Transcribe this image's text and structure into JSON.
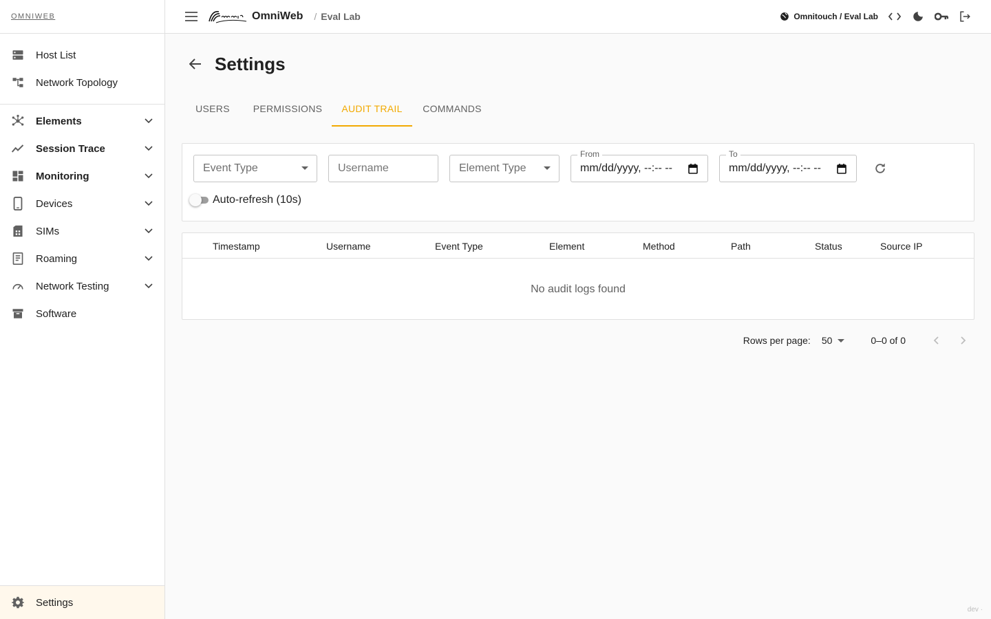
{
  "sidebar": {
    "brand": "OMNIWEB",
    "top_items": [
      {
        "label": "Host List",
        "icon": "server-icon"
      },
      {
        "label": "Network Topology",
        "icon": "topology-icon"
      }
    ],
    "groups": [
      {
        "label": "Elements",
        "icon": "hub-icon",
        "bold": true
      },
      {
        "label": "Session Trace",
        "icon": "trending-icon",
        "bold": true
      },
      {
        "label": "Monitoring",
        "icon": "dashboard-icon",
        "bold": true
      },
      {
        "label": "Devices",
        "icon": "phone-icon",
        "bold": false
      },
      {
        "label": "SIMs",
        "icon": "sim-icon",
        "bold": false
      },
      {
        "label": "Roaming",
        "icon": "book-icon",
        "bold": false
      },
      {
        "label": "Network Testing",
        "icon": "speed-icon",
        "bold": false
      }
    ],
    "software": "Software",
    "settings": "Settings"
  },
  "topbar": {
    "app_name": "OmniWeb",
    "crumb_sep": "/",
    "crumb": "Eval Lab",
    "tenant": "Omnitouch / Eval Lab"
  },
  "page": {
    "title": "Settings",
    "tabs": [
      {
        "label": "USERS",
        "active": false
      },
      {
        "label": "PERMISSIONS",
        "active": false
      },
      {
        "label": "AUDIT TRAIL",
        "active": true
      },
      {
        "label": "COMMANDS",
        "active": false
      }
    ]
  },
  "filters": {
    "event_type_placeholder": "Event Type",
    "username_placeholder": "Username",
    "element_type_placeholder": "Element Type",
    "from_label": "From",
    "from_value": "mm/dd/yyyy, --:-- --",
    "to_label": "To",
    "to_value": "mm/dd/yyyy, --:-- --",
    "auto_refresh_label": "Auto-refresh (10s)",
    "auto_refresh_on": false
  },
  "table": {
    "columns": [
      "Timestamp",
      "Username",
      "Event Type",
      "Element",
      "Method",
      "Path",
      "Status",
      "Source IP"
    ],
    "empty_text": "No audit logs found"
  },
  "pagination": {
    "rows_per_page_label": "Rows per page:",
    "rows_per_page": "50",
    "range": "0–0 of 0"
  },
  "footer": {
    "env": "dev ·"
  },
  "colors": {
    "accent": "#f2a900",
    "settings_bg": "#fff8ec"
  }
}
